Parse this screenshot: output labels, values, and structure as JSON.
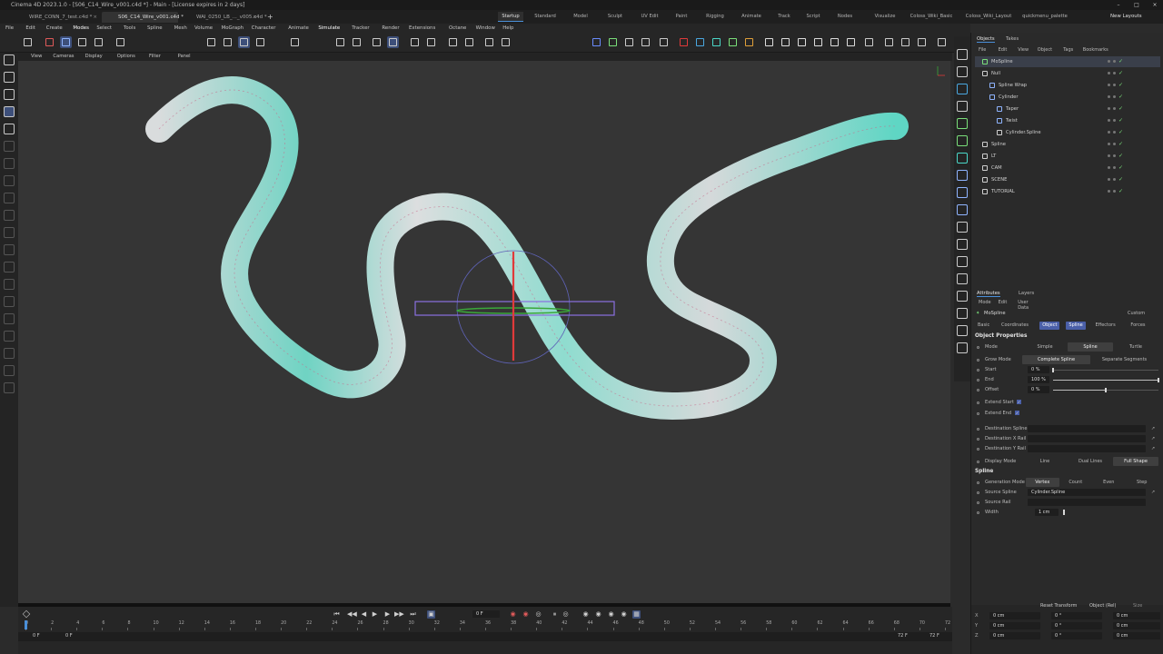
{
  "window": {
    "title": "Cinema 4D 2023.1.0 - [S06_C14_Wire_v001.c4d *] - Main - [License expires in 2 days]"
  },
  "doc_tabs": [
    {
      "label": "WIRE_CONN_7_test.c4d *"
    },
    {
      "label": "S06_C14_Wire_v001.c4d *"
    },
    {
      "label": "WAI_0250_LB_..._v005.c4d *"
    }
  ],
  "new_tab_symbol": "+",
  "layouts": [
    "Startup",
    "Standard",
    "Model",
    "Sculpt",
    "UV Edit",
    "Paint",
    "Rigging",
    "Animate",
    "Track",
    "Script",
    "Nodes",
    "Visualize",
    "Coloss_Wiki_Basic",
    "Coloss_Wiki_Layout",
    "quickmenu_palette"
  ],
  "layout_active": "Startup",
  "new_layouts_label": "New Layouts",
  "main_menu": [
    "File",
    "Edit",
    "Create",
    "Modes",
    "Select",
    "Tools",
    "Spline",
    "Mesh",
    "Volume",
    "MoGraph",
    "Character",
    "Animate",
    "Simulate",
    "Tracker",
    "Render",
    "Extensions",
    "Octane",
    "Window",
    "Help"
  ],
  "viewport_menu": [
    "View",
    "Cameras",
    "Display",
    "Options",
    "Filter",
    "Panel"
  ],
  "objects_panel": {
    "tabs": [
      "Objects",
      "Takes"
    ],
    "menu": [
      "File",
      "Edit",
      "View",
      "Object",
      "Tags",
      "Bookmarks"
    ],
    "items": [
      {
        "name": "MoSpline",
        "depth": 0,
        "color": "#7adf7a",
        "selected": true
      },
      {
        "name": "Null",
        "depth": 0,
        "color": "#cfcfcf"
      },
      {
        "name": "Spline Wrap",
        "depth": 1,
        "color": "#8fb4ff"
      },
      {
        "name": "Cylinder",
        "depth": 1,
        "color": "#8fb4ff"
      },
      {
        "name": "Taper",
        "depth": 2,
        "color": "#8fb4ff"
      },
      {
        "name": "Twist",
        "depth": 2,
        "color": "#8fb4ff"
      },
      {
        "name": "Cylinder.Spline",
        "depth": 2,
        "color": "#cfcfcf"
      },
      {
        "name": "Spline",
        "depth": 0,
        "color": "#cfcfcf"
      },
      {
        "name": "LT",
        "depth": 0,
        "color": "#cfcfcf"
      },
      {
        "name": "CAM",
        "depth": 0,
        "color": "#cfcfcf"
      },
      {
        "name": "SCENE",
        "depth": 0,
        "color": "#cfcfcf"
      },
      {
        "name": "TUTORIAL",
        "depth": 0,
        "color": "#cfcfcf"
      }
    ]
  },
  "attributes": {
    "tabs": [
      "Attributes",
      "Layers"
    ],
    "menu": [
      "Mode",
      "Edit",
      "User Data"
    ],
    "object_name": "MoSpline",
    "preset": "Custom",
    "subtabs": [
      "Basic",
      "Coordinates",
      "Object",
      "Spline",
      "Effectors",
      "Forces"
    ],
    "subtabs_active": [
      "Object",
      "Spline"
    ],
    "section_object": "Object Properties",
    "mode_label": "Mode",
    "modes": [
      "Simple",
      "Spline",
      "Turtle"
    ],
    "mode_active": "Spline",
    "grow_mode_label": "Grow Mode",
    "grow_modes": [
      "Complete Spline",
      "Separate Segments"
    ],
    "grow_mode_active": "Complete Spline",
    "start_label": "Start",
    "start_value": "0 %",
    "start_fraction": 0.0,
    "end_label": "End",
    "end_value": "100 %",
    "end_fraction": 1.0,
    "offset_label": "Offset",
    "offset_value": "0 %",
    "offset_fraction": 0.5,
    "extend_start_label": "Extend Start",
    "extend_end_label": "Extend End",
    "dest_spline_label": "Destination Spline",
    "dest_x_label": "Destination X Rail",
    "dest_y_label": "Destination Y Rail",
    "display_mode_label": "Display Mode",
    "display_modes": [
      "Line",
      "Dual Lines",
      "Full Shape"
    ],
    "display_mode_active": "Full Shape",
    "section_spline": "Spline",
    "generation_mode_label": "Generation Mode",
    "generation_modes": [
      "Vertex",
      "Count",
      "Even",
      "Step"
    ],
    "generation_mode_active": "Vertex",
    "source_spline_label": "Source Spline",
    "source_spline_value": "Cylinder.Spline",
    "source_rail_label": "Source Rail",
    "width_label": "Width",
    "width_value": "1 cm"
  },
  "coordinates": {
    "reset_label": "Reset Transform",
    "mode_label": "Object (Rel)",
    "size_label": "Size",
    "rows": [
      {
        "axis": "X",
        "pos": "0 cm",
        "rot": "0 °",
        "scale": "0 cm"
      },
      {
        "axis": "Y",
        "pos": "0 cm",
        "rot": "0 °",
        "scale": "0 cm"
      },
      {
        "axis": "Z",
        "pos": "0 cm",
        "rot": "0 °",
        "scale": "0 cm"
      }
    ]
  },
  "timeline": {
    "current_frame": "0 F",
    "start_frame": "0 F",
    "range_start": "0 F",
    "end_frame": "72 F",
    "range_end": "72 F",
    "ticks": [
      "0",
      "2",
      "4",
      "6",
      "8",
      "10",
      "12",
      "14",
      "16",
      "18",
      "20",
      "22",
      "24",
      "26",
      "28",
      "30",
      "32",
      "34",
      "36",
      "38",
      "40",
      "42",
      "44",
      "46",
      "48",
      "50",
      "52",
      "54",
      "56",
      "58",
      "60",
      "62",
      "64",
      "66",
      "68",
      "70",
      "72"
    ]
  },
  "colors": {
    "accent": "#4a8fd8",
    "selection": "#4a5fa8",
    "wire_teal": "#5fd6c4",
    "wire_light": "#d6d9da",
    "axis_y": "#e03a3a",
    "axis_x": "#3aa83a",
    "gizmo": "#6a5fd8"
  }
}
